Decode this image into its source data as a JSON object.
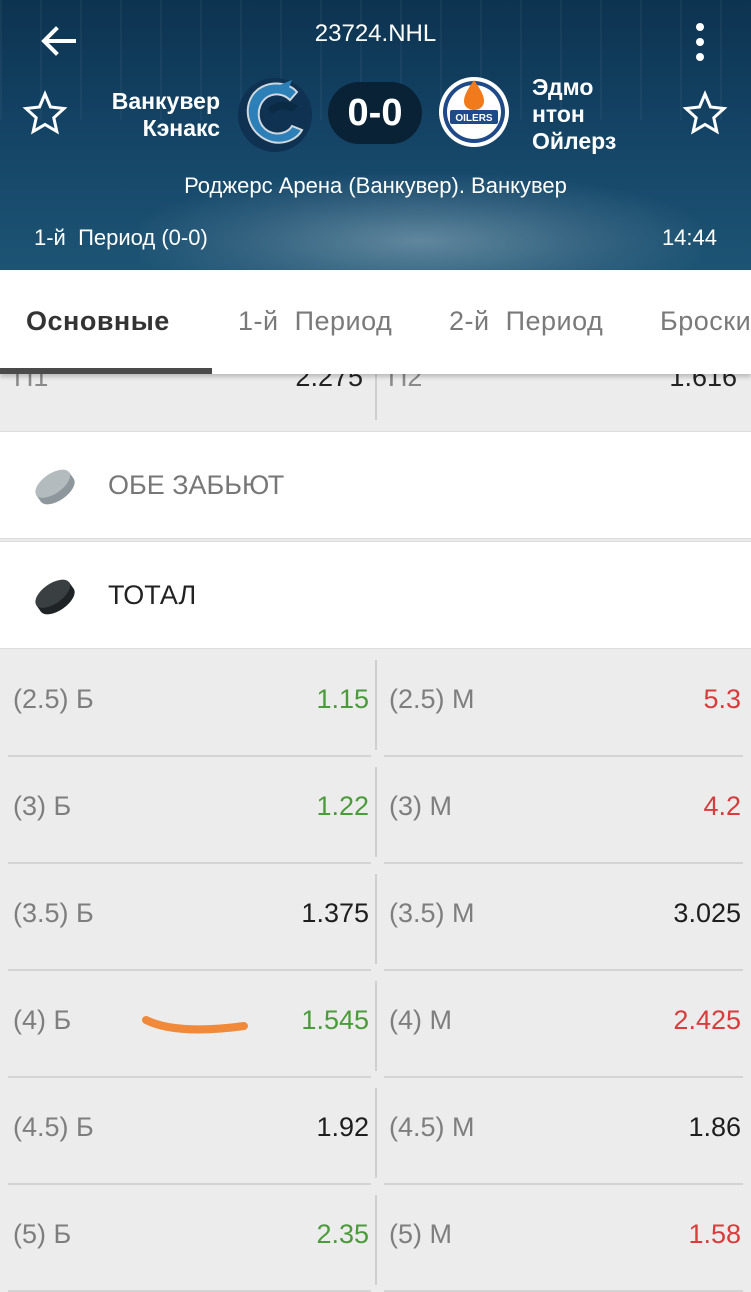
{
  "header": {
    "match_id": "23724.NHL",
    "home_team": "Ванкувер\nКэнакс",
    "away_team": "Эдмо\nнтон\nОйлерз",
    "score": "0-0",
    "venue": "Роджерс Арена (Ванкувер). Ванкувер",
    "period": "1-й  Период (0-0)",
    "clock": "14:44",
    "away_logo_text": "OILERS"
  },
  "tabs": [
    {
      "label": "Основные"
    },
    {
      "label": "1-й  Период"
    },
    {
      "label": "2-й  Период"
    },
    {
      "label": "Броски"
    }
  ],
  "partial_row": {
    "left_label": "П1",
    "left_value": "2.275",
    "right_label": "П2",
    "right_value": "1.616"
  },
  "sections": {
    "both_score": "ОБЕ ЗАБЬЮТ",
    "total": "ТОТАЛ"
  },
  "total_rows": [
    {
      "over_label": "(2.5) Б",
      "over_value": "1.15",
      "over_trend": "up",
      "under_label": "(2.5) М",
      "under_value": "5.3",
      "under_trend": "down"
    },
    {
      "over_label": "(3) Б",
      "over_value": "1.22",
      "over_trend": "up",
      "under_label": "(3) М",
      "under_value": "4.2",
      "under_trend": "down"
    },
    {
      "over_label": "(3.5) Б",
      "over_value": "1.375",
      "over_trend": "neutral",
      "under_label": "(3.5) М",
      "under_value": "3.025",
      "under_trend": "neutral"
    },
    {
      "over_label": "(4) Б",
      "over_value": "1.545",
      "over_trend": "up",
      "under_label": "(4) М",
      "under_value": "2.425",
      "under_trend": "down"
    },
    {
      "over_label": "(4.5) Б",
      "over_value": "1.92",
      "over_trend": "neutral",
      "under_label": "(4.5) М",
      "under_value": "1.86",
      "under_trend": "neutral"
    },
    {
      "over_label": "(5) Б",
      "over_value": "2.35",
      "over_trend": "up",
      "under_label": "(5) М",
      "under_value": "1.58",
      "under_trend": "down"
    }
  ],
  "colors": {
    "odds_up": "#4a9b3a",
    "odds_down": "#d83c3c",
    "odds_neutral": "#1e1e1e",
    "header_bg": "#123f60",
    "scribble": "#f08a3a"
  },
  "icons": [
    "back-arrow-icon",
    "more-vert-icon",
    "star-outline-icon",
    "canucks-logo-icon",
    "oilers-logo-icon",
    "puck-icon"
  ]
}
